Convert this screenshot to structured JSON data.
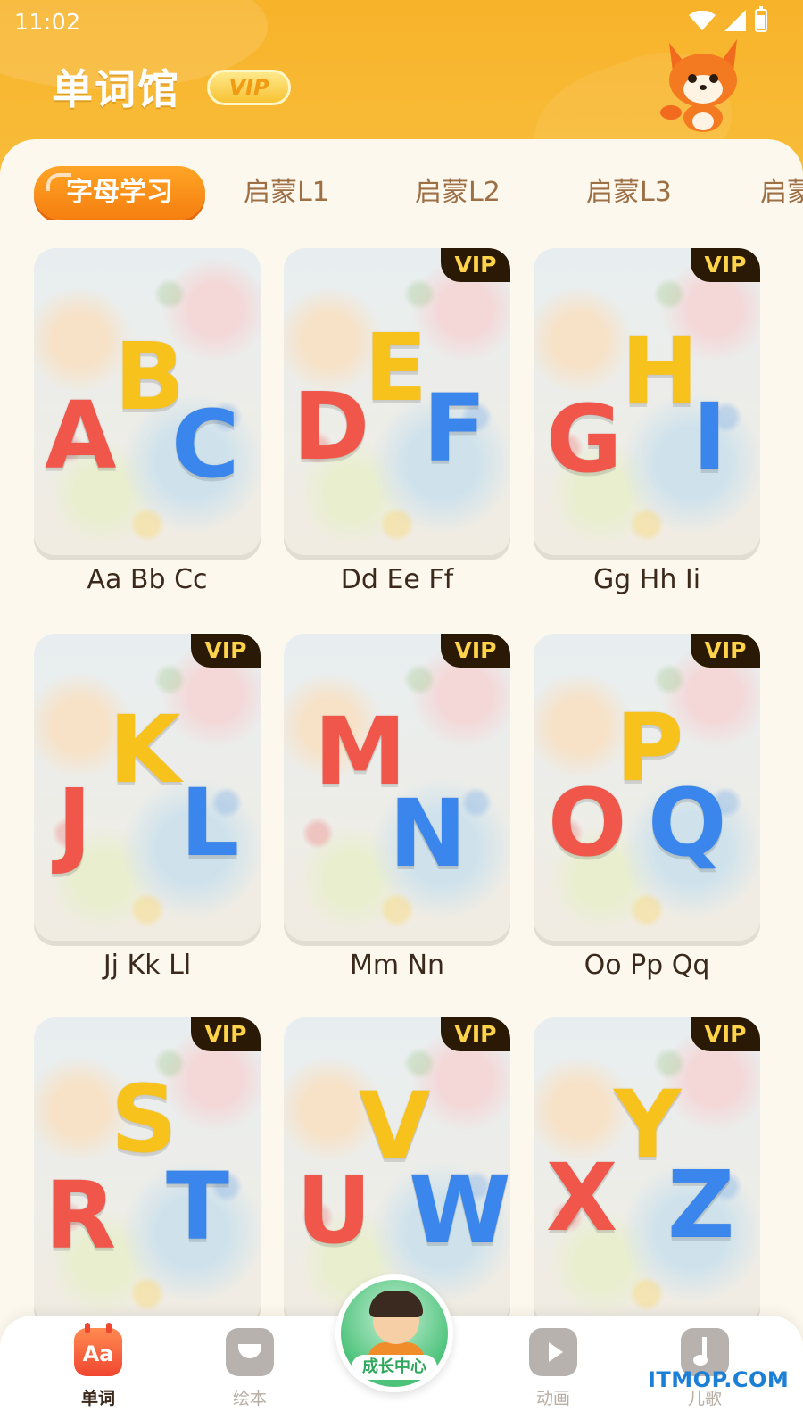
{
  "status": {
    "time": "11:02"
  },
  "header": {
    "title": "单词馆",
    "vip_label": "VIP"
  },
  "tabs": [
    {
      "label": "字母学习",
      "active": true
    },
    {
      "label": "启蒙L1"
    },
    {
      "label": "启蒙L2"
    },
    {
      "label": "启蒙L3"
    },
    {
      "label": "启蒙"
    }
  ],
  "cards": [
    {
      "label": "Aa Bb Cc",
      "vip": false,
      "letters": [
        "A",
        "B",
        "C"
      ]
    },
    {
      "label": "Dd Ee Ff",
      "vip": true,
      "vip_label": "VIP",
      "letters": [
        "D",
        "E",
        "F"
      ]
    },
    {
      "label": "Gg Hh Ii",
      "vip": true,
      "vip_label": "VIP",
      "letters": [
        "G",
        "H",
        "I"
      ]
    },
    {
      "label": "Jj Kk Ll",
      "vip": true,
      "vip_label": "VIP",
      "letters": [
        "J",
        "K",
        "L"
      ]
    },
    {
      "label": "Mm Nn",
      "vip": true,
      "vip_label": "VIP",
      "letters": [
        "M",
        "N"
      ]
    },
    {
      "label": "Oo Pp Qq",
      "vip": true,
      "vip_label": "VIP",
      "letters": [
        "O",
        "P",
        "Q"
      ]
    },
    {
      "label": "",
      "vip": true,
      "vip_label": "VIP",
      "letters": [
        "R",
        "S",
        "T"
      ]
    },
    {
      "label": "",
      "vip": true,
      "vip_label": "VIP",
      "letters": [
        "U",
        "V",
        "W"
      ]
    },
    {
      "label": "",
      "vip": true,
      "vip_label": "VIP",
      "letters": [
        "X",
        "Y",
        "Z"
      ]
    }
  ],
  "bottom_nav": {
    "words": {
      "label": "单词",
      "icon_text": "Aa"
    },
    "books": {
      "label": "绘本"
    },
    "center": {
      "label": "成长中心"
    },
    "animation": {
      "label": "动画"
    },
    "songs": {
      "label": "儿歌"
    }
  },
  "watermark": "ITMOP.COM",
  "colors": {
    "accent": "#f7b32a",
    "tab_active": "#f57e0f",
    "letter_red": "#f0574a",
    "letter_yellow": "#f8c21d",
    "letter_blue": "#3a86ec"
  }
}
